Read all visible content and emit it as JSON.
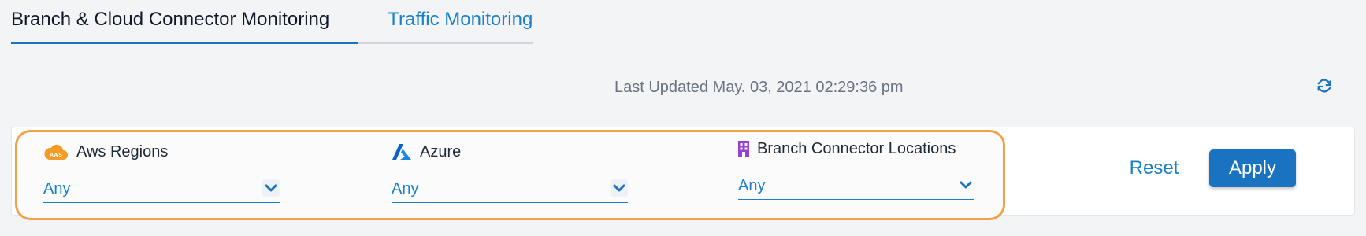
{
  "tabs": [
    {
      "label": "Branch & Cloud Connector Monitoring",
      "active": true
    },
    {
      "label": "Traffic Monitoring",
      "active": false
    }
  ],
  "status": {
    "last_updated": "Last Updated May. 03, 2021 02:29:36 pm"
  },
  "filters": {
    "aws": {
      "icon": "aws-cloud-icon",
      "icon_text": "AWS",
      "label": "Aws Regions",
      "value": "Any"
    },
    "azure": {
      "icon": "azure-icon",
      "label": "Azure",
      "value": "Any"
    },
    "branch": {
      "icon": "building-icon",
      "label": "Branch Connector Locations",
      "value": "Any"
    }
  },
  "actions": {
    "reset_label": "Reset",
    "apply_label": "Apply"
  },
  "colors": {
    "accent": "#1a73c1",
    "link": "#1a7fc8",
    "highlight_border": "#f2a14a",
    "aws_orange": "#f59a23",
    "azure_blue": "#0a61c7",
    "building_purple": "#9b3fd1"
  }
}
